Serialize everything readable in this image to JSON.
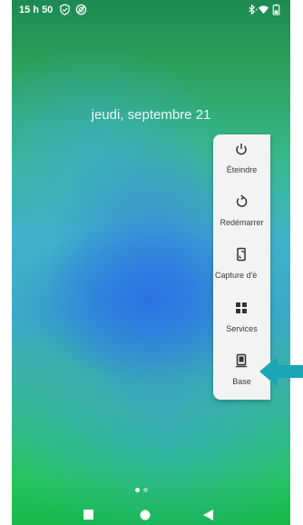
{
  "status_bar": {
    "time": "15 h 50",
    "left_icons": [
      "shield-check-icon",
      "no-disturb-icon"
    ],
    "right_icons": [
      "bluetooth-icon",
      "wifi-icon",
      "battery-icon"
    ]
  },
  "lock_screen": {
    "date": "jeudi, septembre 21",
    "page_indicator": {
      "pages": 2,
      "current": 1
    }
  },
  "power_menu": {
    "items": [
      {
        "label": "Éteindre",
        "icon": "power-icon"
      },
      {
        "label": "Redémarrer",
        "icon": "restart-icon"
      },
      {
        "label": "Capture d'é",
        "icon": "screenshot-icon"
      },
      {
        "label": "Services",
        "icon": "grid-icon"
      },
      {
        "label": "Base",
        "icon": "phone-icon"
      }
    ]
  },
  "nav_bar": {
    "icons": [
      "recents-square-icon",
      "home-circle-icon",
      "back-triangle-icon"
    ]
  },
  "annotation": {
    "pointer": "arrow-left-icon",
    "color": "#1aa6b7"
  }
}
